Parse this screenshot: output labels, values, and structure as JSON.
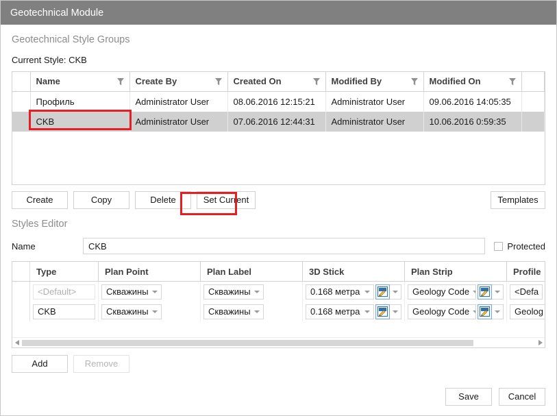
{
  "window": {
    "title": "Geotechnical Module"
  },
  "style_groups": {
    "heading": "Geotechnical Style Groups",
    "current_style_label": "Current Style: CKB",
    "columns": [
      {
        "label": "Name",
        "filter_icon": "filter-icon"
      },
      {
        "label": "Create By",
        "filter_icon": "filter-icon"
      },
      {
        "label": "Created On",
        "filter_icon": "filter-icon"
      },
      {
        "label": "Modified By",
        "filter_icon": "filter-icon"
      },
      {
        "label": "Modified On",
        "filter_icon": "filter-icon"
      }
    ],
    "rows": [
      {
        "name": "Профиль",
        "create_by": "Administrator User",
        "created_on": "08.06.2016 12:15:21",
        "modified_by": "Administrator User",
        "modified_on": "09.06.2016 14:05:35",
        "selected": false
      },
      {
        "name": "CKB",
        "create_by": "Administrator User",
        "created_on": "07.06.2016 12:44:31",
        "modified_by": "Administrator User",
        "modified_on": "10.06.2016 0:59:35",
        "selected": true
      }
    ]
  },
  "toolbar": {
    "create_label": "Create",
    "copy_label": "Copy",
    "delete_label": "Delete",
    "set_current_label": "Set Current",
    "templates_label": "Templates"
  },
  "styles_editor": {
    "heading": "Styles Editor",
    "name_label": "Name",
    "name_value": "CKB",
    "protected_label": "Protected",
    "protected_checked": false,
    "columns": [
      "Type",
      "Plan Point",
      "Plan Label",
      "3D Stick",
      "Plan Strip",
      "Profile"
    ],
    "rows": [
      {
        "type": "<Default>",
        "type_muted": true,
        "plan_point": "Скважины",
        "plan_label": "Скважины",
        "stick_3d": "0.168 метра",
        "plan_strip": "Geology Code",
        "profile": "<Defa",
        "edit_icon": "edit-pencil-icon"
      },
      {
        "type": "CKB",
        "type_muted": false,
        "plan_point": "Скважины",
        "plan_label": "Скважины",
        "stick_3d": "0.168 метра",
        "plan_strip": "Geology Code",
        "profile": "Geolog",
        "edit_icon": "edit-pencil-icon"
      }
    ],
    "add_label": "Add",
    "remove_label": "Remove",
    "remove_disabled": true
  },
  "footer": {
    "save_label": "Save",
    "cancel_label": "Cancel"
  },
  "colors": {
    "titlebar_bg": "#808080",
    "annotation_red": "#e31e24",
    "selected_row_bg": "#d0d0d0",
    "muted_text": "#8c8c8c"
  }
}
